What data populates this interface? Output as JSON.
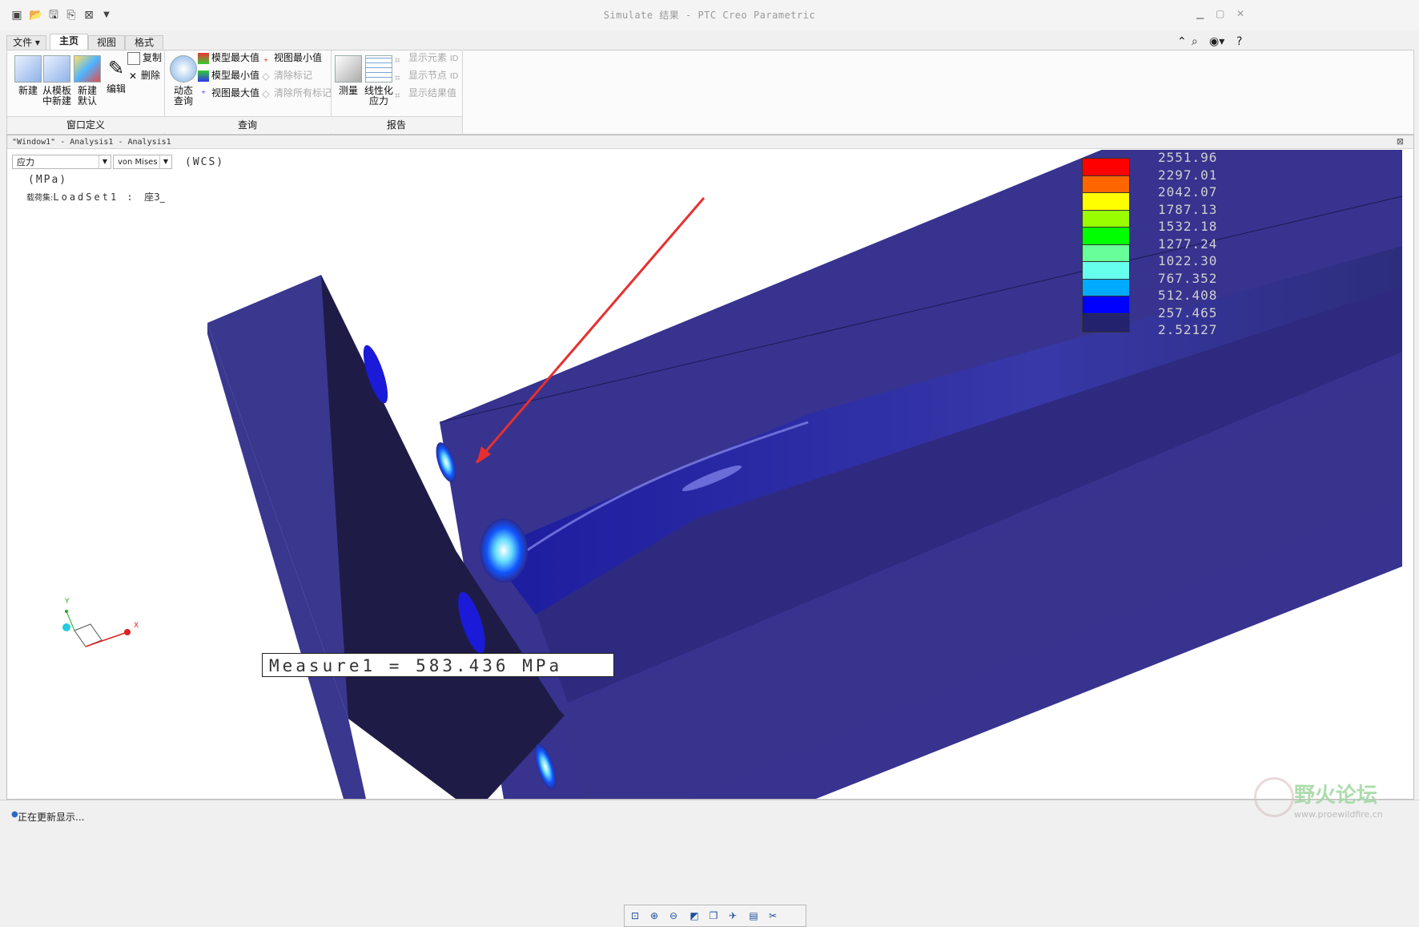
{
  "window": {
    "title": "Simulate 结果 - PTC Creo Parametric"
  },
  "quick_access": {
    "icons": [
      "new-window-icon",
      "open-icon",
      "save-icon",
      "save-all-icon",
      "close-icon",
      "customize-icon"
    ]
  },
  "tabs": [
    {
      "label": "文件"
    },
    {
      "label": "主页"
    },
    {
      "label": "视图"
    },
    {
      "label": "格式"
    }
  ],
  "ribbon": {
    "window_def": {
      "new": "新建",
      "from_template_1": "从模板",
      "from_template_2": "中新建",
      "new_default_1": "新建",
      "new_default_2": "默认",
      "edit": "编辑",
      "copy": "复制",
      "delete": "删除",
      "group": "窗口定义"
    },
    "query": {
      "dynamic_1": "动态",
      "dynamic_2": "查询",
      "model_max": "模型最大值",
      "model_min": "模型最小值",
      "view_max": "视图最大值",
      "view_min": "视图最小值",
      "clear_mark": "清除标记",
      "clear_all": "清除所有标记",
      "group": "查询"
    },
    "report": {
      "measure": "测量",
      "linear_1": "线性化",
      "linear_2": "应力",
      "show_element": "显示元素",
      "show_node": "显示节点",
      "show_result": "显示结果值",
      "id": "ID",
      "group": "报告"
    }
  },
  "graphics": {
    "window_title": "\"Window1\" - Analysis1 - Analysis1",
    "quantity": "应力",
    "component": "von Mises",
    "wcs": "(WCS)",
    "units": "(MPa)",
    "loadset_label": "载荷集:",
    "loadset_value": "LoadSet1 :",
    "loadset_extra": "座3_",
    "measure_text": "Measure1 = 583.436  MPa",
    "axis_x": "X",
    "axis_y": "Y"
  },
  "legend": {
    "colors": [
      "#ff0000",
      "#ff6600",
      "#ffff00",
      "#99ff00",
      "#00ff00",
      "#66ff99",
      "#66ffee",
      "#00aaff",
      "#0000ff",
      "#22226e"
    ],
    "values": [
      "2551.96",
      "2297.01",
      "2042.07",
      "1787.13",
      "1532.18",
      "1277.24",
      "1022.30",
      "767.352",
      "512.408",
      "257.465",
      "2.52127"
    ]
  },
  "status": {
    "text": "正在更新显示..."
  },
  "watermark": {
    "name": "野火论坛",
    "url": "www.proewildfire.cn"
  }
}
